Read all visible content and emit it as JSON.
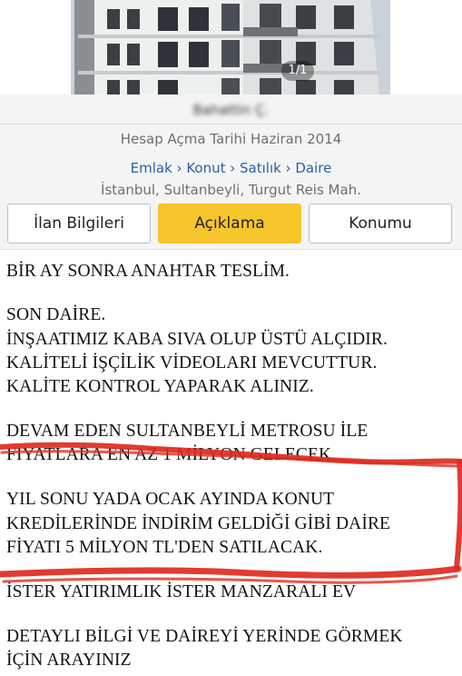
{
  "gallery": {
    "counter": "1/1"
  },
  "seller": {
    "name": "Bahattin Ç.",
    "account_date": "Hesap Açma Tarihi Haziran 2014"
  },
  "breadcrumb": "Emlak › Konut › Satılık › Daire",
  "location": "İstanbul, Sultanbeyli, Turgut Reis Mah.",
  "tabs": [
    {
      "label": "İlan Bilgileri",
      "active": false
    },
    {
      "label": "Açıklama",
      "active": true
    },
    {
      "label": "Konumu",
      "active": false
    }
  ],
  "description": {
    "lines": [
      "BİR AY SONRA ANAHTAR TESLİM.",
      "SON DAİRE.",
      "İNŞAATIMIZ KABA SIVA OLUP ÜSTÜ ALÇIDIR.",
      "KALİTELİ İŞÇİLİK VİDEOLARI MEVCUTTUR.",
      "KALİTE KONTROL YAPARAK ALINIZ.",
      "DEVAM EDEN SULTANBEYLİ METROSU İLE",
      "FİYATLARA EN AZ 1 MİLYON GELECEK.",
      "YIL SONU YADA OCAK AYINDA KONUT",
      "KREDİLERİNDE İNDİRİM GELDİĞİ GİBİ DAİRE",
      "FİYATI 5 MİLYON TL'DEN SATILACAK.",
      "İSTER YATIRIMLIK İSTER MANZARALI EV",
      "DETAYLI BİLGİ VE DAİREYİ YERİNDE GÖRMEK",
      "İÇİN ARAYINIZ"
    ]
  },
  "colors": {
    "accent_tab": "#f7c52c",
    "link": "#2b5fa8",
    "annotation": "#e02a1f"
  }
}
